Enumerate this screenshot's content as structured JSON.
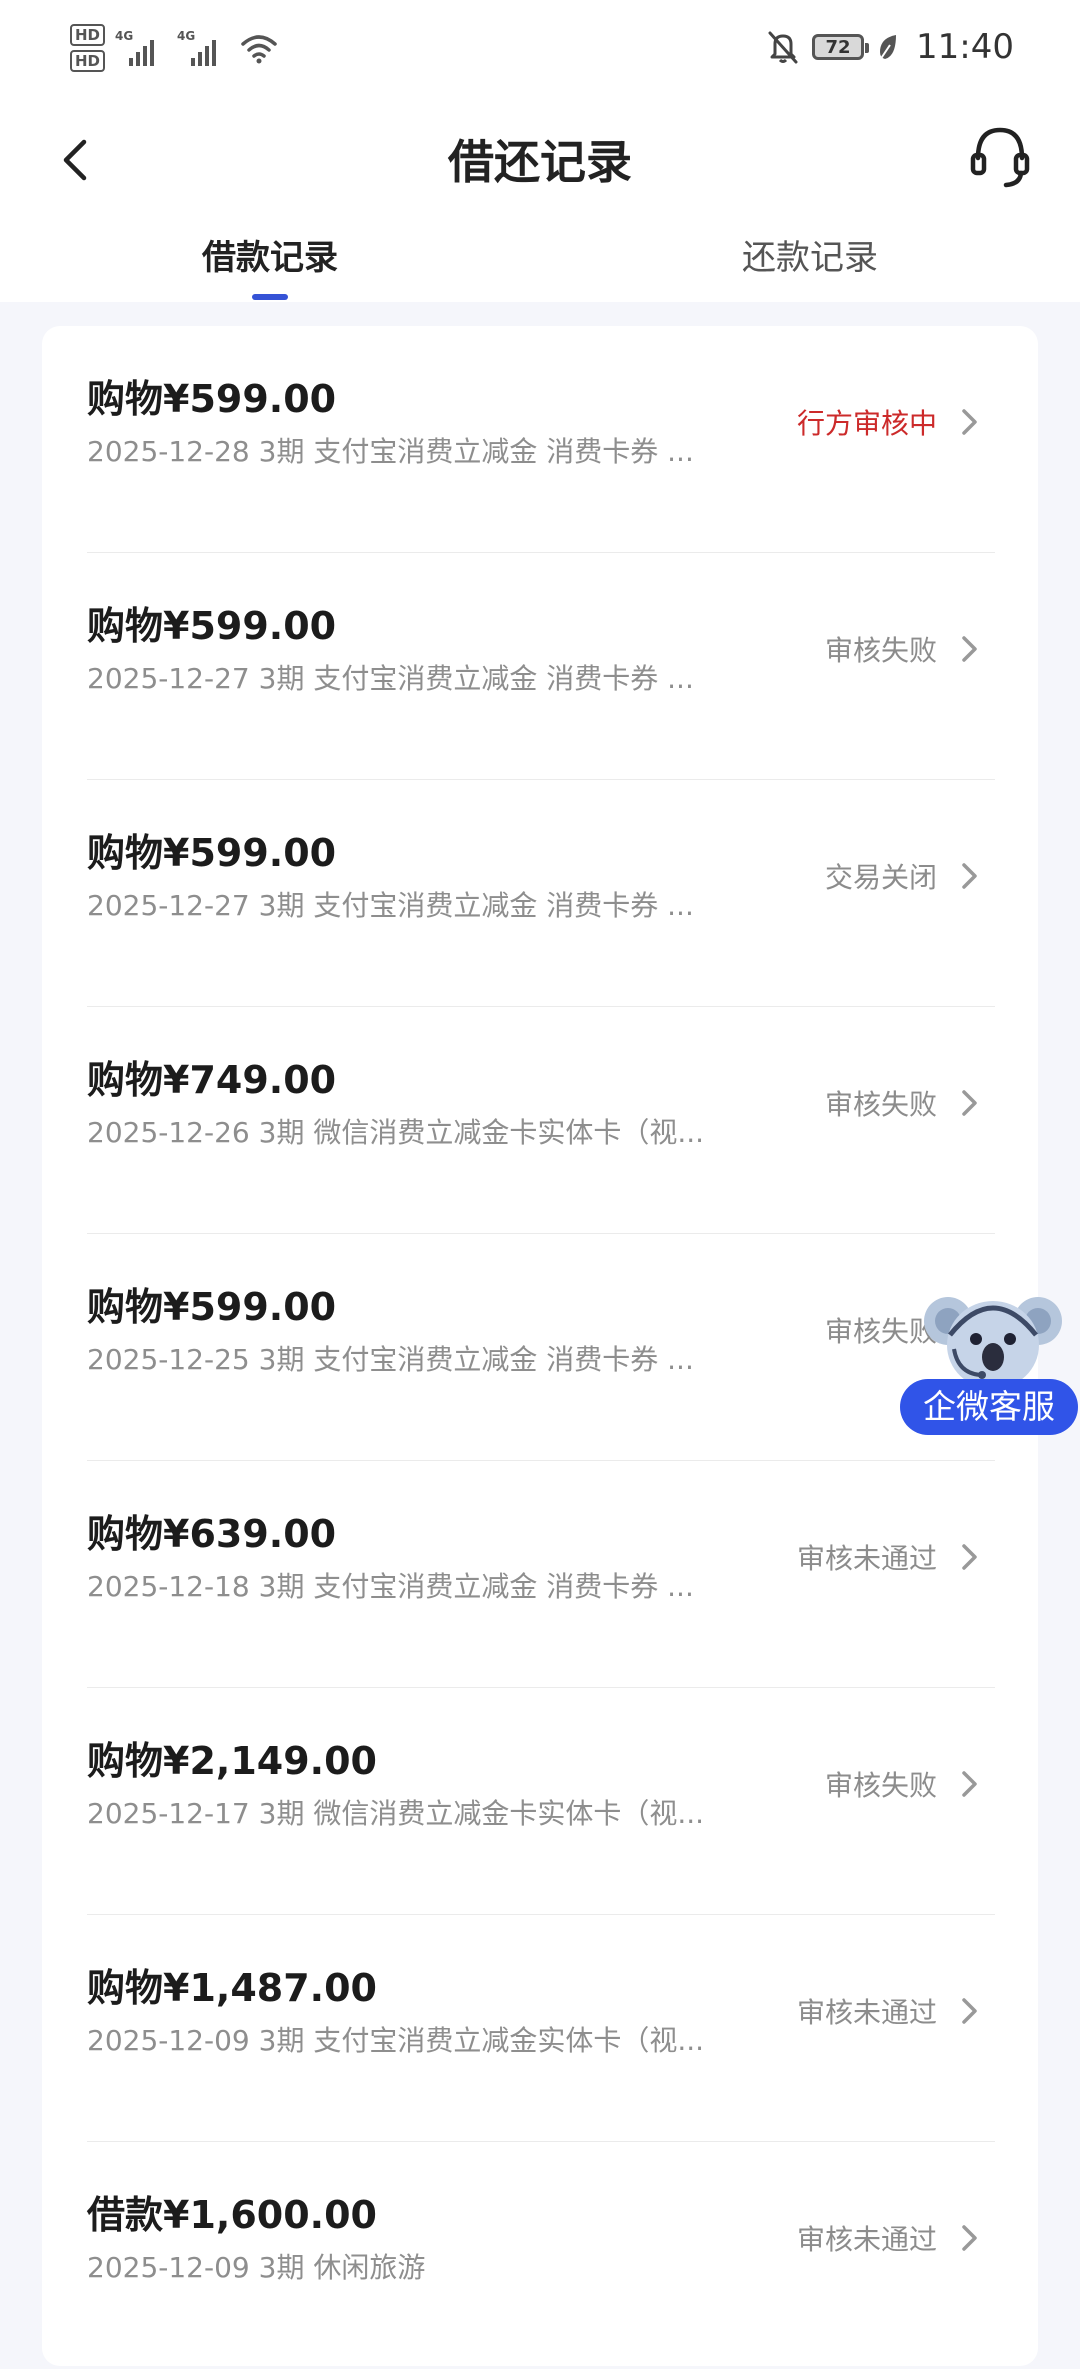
{
  "status_bar": {
    "sim1": "HD",
    "sim2": "HD",
    "network1": "4G",
    "network2": "4G",
    "battery": "72",
    "time": "11:40",
    "icons": [
      "signal-icon",
      "wifi-icon",
      "bell-muted-icon",
      "battery-icon",
      "leaf-icon"
    ]
  },
  "header": {
    "title": "借还记录",
    "back_icon": "chevron-left-icon",
    "service_icon": "headset-icon"
  },
  "tabs": [
    {
      "label": "借款记录",
      "active": true
    },
    {
      "label": "还款记录",
      "active": false
    }
  ],
  "records": [
    {
      "amount": "购物¥599.00",
      "meta": "2025-12-28 3期  支付宝消费立减金 消费卡券 ...",
      "status": "行方审核中",
      "status_type": "pending"
    },
    {
      "amount": "购物¥599.00",
      "meta": "2025-12-27 3期  支付宝消费立减金 消费卡券 ...",
      "status": "审核失败",
      "status_type": "normal"
    },
    {
      "amount": "购物¥599.00",
      "meta": "2025-12-27 3期  支付宝消费立减金 消费卡券 ...",
      "status": "交易关闭",
      "status_type": "normal"
    },
    {
      "amount": "购物¥749.00",
      "meta": "2025-12-26 3期  微信消费立减金卡实体卡（视...",
      "status": "审核失败",
      "status_type": "normal"
    },
    {
      "amount": "购物¥599.00",
      "meta": "2025-12-25 3期  支付宝消费立减金 消费卡券 ...",
      "status": "审核失败",
      "status_type": "normal"
    },
    {
      "amount": "购物¥639.00",
      "meta": "2025-12-18 3期  支付宝消费立减金 消费卡券 ...",
      "status": "审核未通过",
      "status_type": "normal"
    },
    {
      "amount": "购物¥2,149.00",
      "meta": "2025-12-17 3期  微信消费立减金卡实体卡（视...",
      "status": "审核失败",
      "status_type": "normal"
    },
    {
      "amount": "购物¥1,487.00",
      "meta": "2025-12-09 3期  支付宝消费立减金实体卡（视...",
      "status": "审核未通过",
      "status_type": "normal"
    },
    {
      "amount": "借款¥1,600.00",
      "meta": "2025-12-09 3期  休闲旅游",
      "status": "审核未通过",
      "status_type": "normal"
    }
  ],
  "floating_service": {
    "label": "企微客服",
    "icon": "koala-icon"
  },
  "colors": {
    "accent": "#3553d6",
    "pending_status": "#cc2a2a",
    "float_button": "#3054e8"
  }
}
